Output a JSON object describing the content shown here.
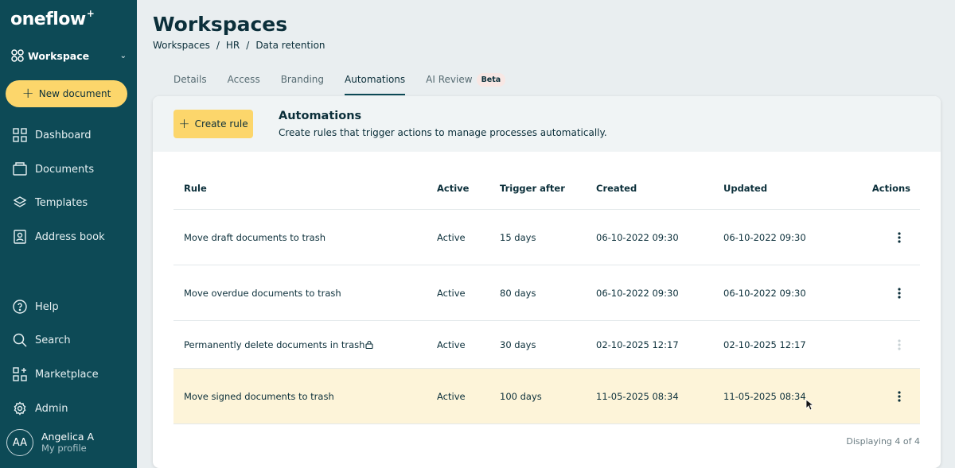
{
  "sidebar": {
    "logo": "oneflow",
    "logo_mark": "+",
    "workspace_label": "Workspace",
    "new_document_label": "New document",
    "nav": {
      "dashboard": "Dashboard",
      "documents": "Documents",
      "templates": "Templates",
      "address_book": "Address book",
      "help": "Help",
      "search": "Search",
      "marketplace": "Marketplace",
      "admin": "Admin"
    },
    "profile": {
      "initials": "AA",
      "name": "Angelica A",
      "subtitle": "My profile"
    }
  },
  "header": {
    "title": "Workspaces",
    "breadcrumb": [
      "Workspaces",
      "HR",
      "Data retention"
    ],
    "breadcrumb_sep": "/"
  },
  "tabs": [
    {
      "label": "Details",
      "active": false
    },
    {
      "label": "Access",
      "active": false
    },
    {
      "label": "Branding",
      "active": false
    },
    {
      "label": "Automations",
      "active": true
    },
    {
      "label": "AI Review",
      "active": false,
      "badge": "Beta"
    }
  ],
  "automations": {
    "create_rule_label": "Create rule",
    "title": "Automations",
    "description": "Create rules that trigger actions to manage processes automatically.",
    "columns": {
      "rule": "Rule",
      "active": "Active",
      "trigger_after": "Trigger after",
      "created": "Created",
      "updated": "Updated",
      "actions": "Actions"
    },
    "rows": [
      {
        "rule": "Move draft documents to trash",
        "active": "Active",
        "trigger_after": "15 days",
        "created": "06-10-2022 09:30",
        "updated": "06-10-2022 09:30",
        "locked": false,
        "actions_enabled": true
      },
      {
        "rule": "Move overdue documents to trash",
        "active": "Active",
        "trigger_after": "80 days",
        "created": "06-10-2022 09:30",
        "updated": "06-10-2022 09:30",
        "locked": false,
        "actions_enabled": true
      },
      {
        "rule": "Permanently delete documents in trash",
        "active": "Active",
        "trigger_after": "30 days",
        "created": "02-10-2025 12:17",
        "updated": "02-10-2025 12:17",
        "locked": true,
        "actions_enabled": false
      },
      {
        "rule": "Move signed documents to trash",
        "active": "Active",
        "trigger_after": "100 days",
        "created": "11-05-2025 08:34",
        "updated": "11-05-2025 08:34",
        "locked": false,
        "actions_enabled": true,
        "highlighted": true
      }
    ],
    "footer": "Displaying 4 of 4"
  },
  "icons": {
    "workspace": "workspace-icon",
    "dashboard": "grid-icon",
    "documents": "documents-icon",
    "templates": "layers-icon",
    "address_book": "contact-icon",
    "help": "help-icon",
    "search": "search-icon",
    "marketplace": "marketplace-icon",
    "admin": "gear-icon",
    "lock": "lock-icon",
    "actions": "kebab-menu-icon"
  },
  "colors": {
    "sidebar": "#0d4a56",
    "accent": "#fcd66b",
    "highlight_row": "#fdf4d9",
    "text": "#0b2f3a"
  }
}
